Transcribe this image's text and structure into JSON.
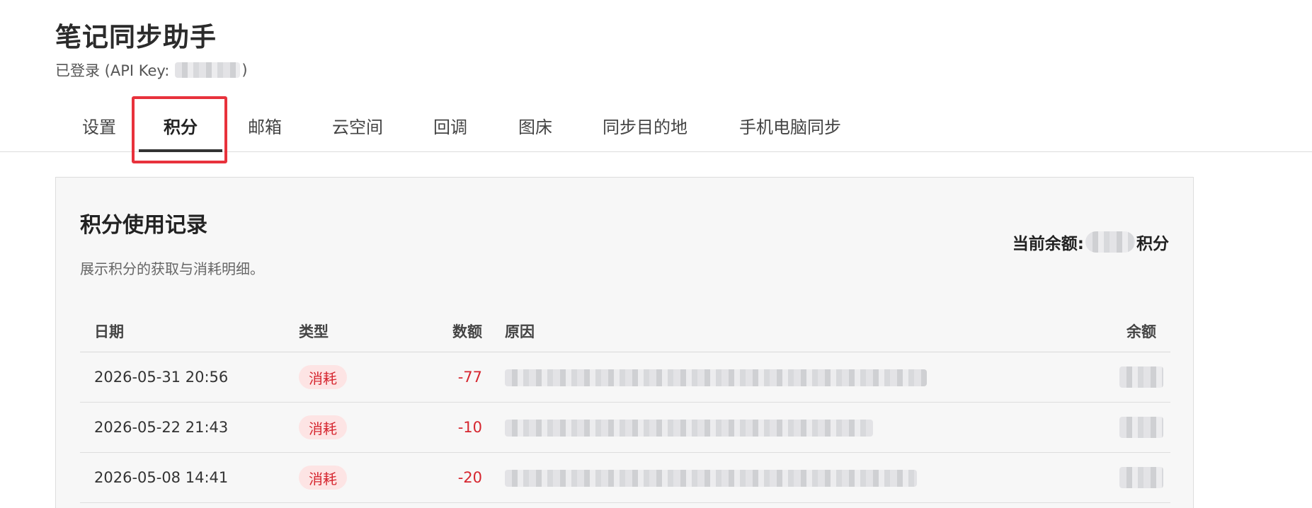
{
  "app": {
    "title": "笔记同步助手"
  },
  "login": {
    "prefix": "已登录 (API Key:",
    "suffix": ")"
  },
  "tabs": [
    {
      "label": "设置",
      "active": false
    },
    {
      "label": "积分",
      "active": true
    },
    {
      "label": "邮箱",
      "active": false
    },
    {
      "label": "云空间",
      "active": false
    },
    {
      "label": "回调",
      "active": false
    },
    {
      "label": "图床",
      "active": false
    },
    {
      "label": "同步目的地",
      "active": false
    },
    {
      "label": "手机电脑同步",
      "active": false
    }
  ],
  "panel": {
    "title": "积分使用记录",
    "description": "展示积分的获取与消耗明细。",
    "balance_label": "当前余额:",
    "balance_unit": "积分"
  },
  "table": {
    "columns": {
      "date": "日期",
      "type": "类型",
      "amount": "数额",
      "reason": "原因",
      "balance": "余额"
    },
    "rows": [
      {
        "date": "2026-05-31 20:56",
        "type": "消耗",
        "amount": "-77"
      },
      {
        "date": "2026-05-22 21:43",
        "type": "消耗",
        "amount": "-10"
      },
      {
        "date": "2026-05-08 14:41",
        "type": "消耗",
        "amount": "-20"
      }
    ]
  },
  "colors": {
    "accent_red": "#d6262f",
    "badge_bg": "#fde4e4",
    "highlight": "#e8323c"
  }
}
